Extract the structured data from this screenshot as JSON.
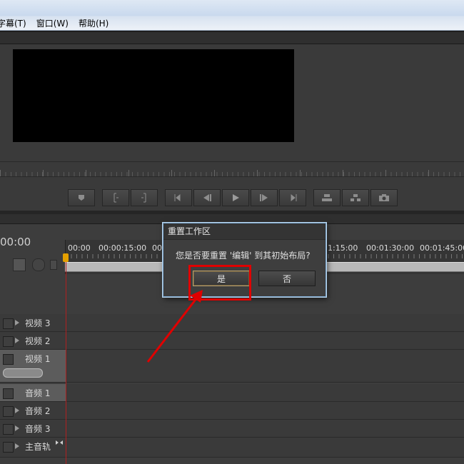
{
  "menu": {
    "items": [
      "字幕(T)",
      "窗口(W)",
      "帮助(H)"
    ]
  },
  "timeline": {
    "timecode": "00:00",
    "ruler_labels": [
      "00:00",
      "00:00:15:00",
      "00",
      "1:15:00",
      "00:01:30:00",
      "00:01:45:00"
    ],
    "tracks": [
      {
        "label": "视频 3",
        "selected": false
      },
      {
        "label": "视频 2",
        "selected": false
      },
      {
        "label": "视频 1",
        "selected": true
      },
      {
        "label": "音频 1",
        "selected": true
      },
      {
        "label": "音频 2",
        "selected": false
      },
      {
        "label": "音频 3",
        "selected": false
      },
      {
        "label": "主音轨",
        "selected": false
      }
    ]
  },
  "dialog": {
    "title": "重置工作区",
    "message": "您是否要重置 '编辑' 到其初始布局?",
    "yes_label": "是",
    "no_label": "否"
  },
  "colors": {
    "annotation": "#e00000",
    "playhead": "#b02020",
    "dialog_border": "#7fa9cf"
  },
  "icons": [
    "marker-icon",
    "in-point-icon",
    "out-point-icon",
    "go-to-in-icon",
    "step-back-icon",
    "play-icon",
    "step-forward-icon",
    "go-to-out-icon",
    "lift-icon",
    "extract-icon",
    "export-frame-icon",
    "snap-icon",
    "marker-set-icon",
    "keyframe-icon",
    "audio-mixer-icon"
  ]
}
